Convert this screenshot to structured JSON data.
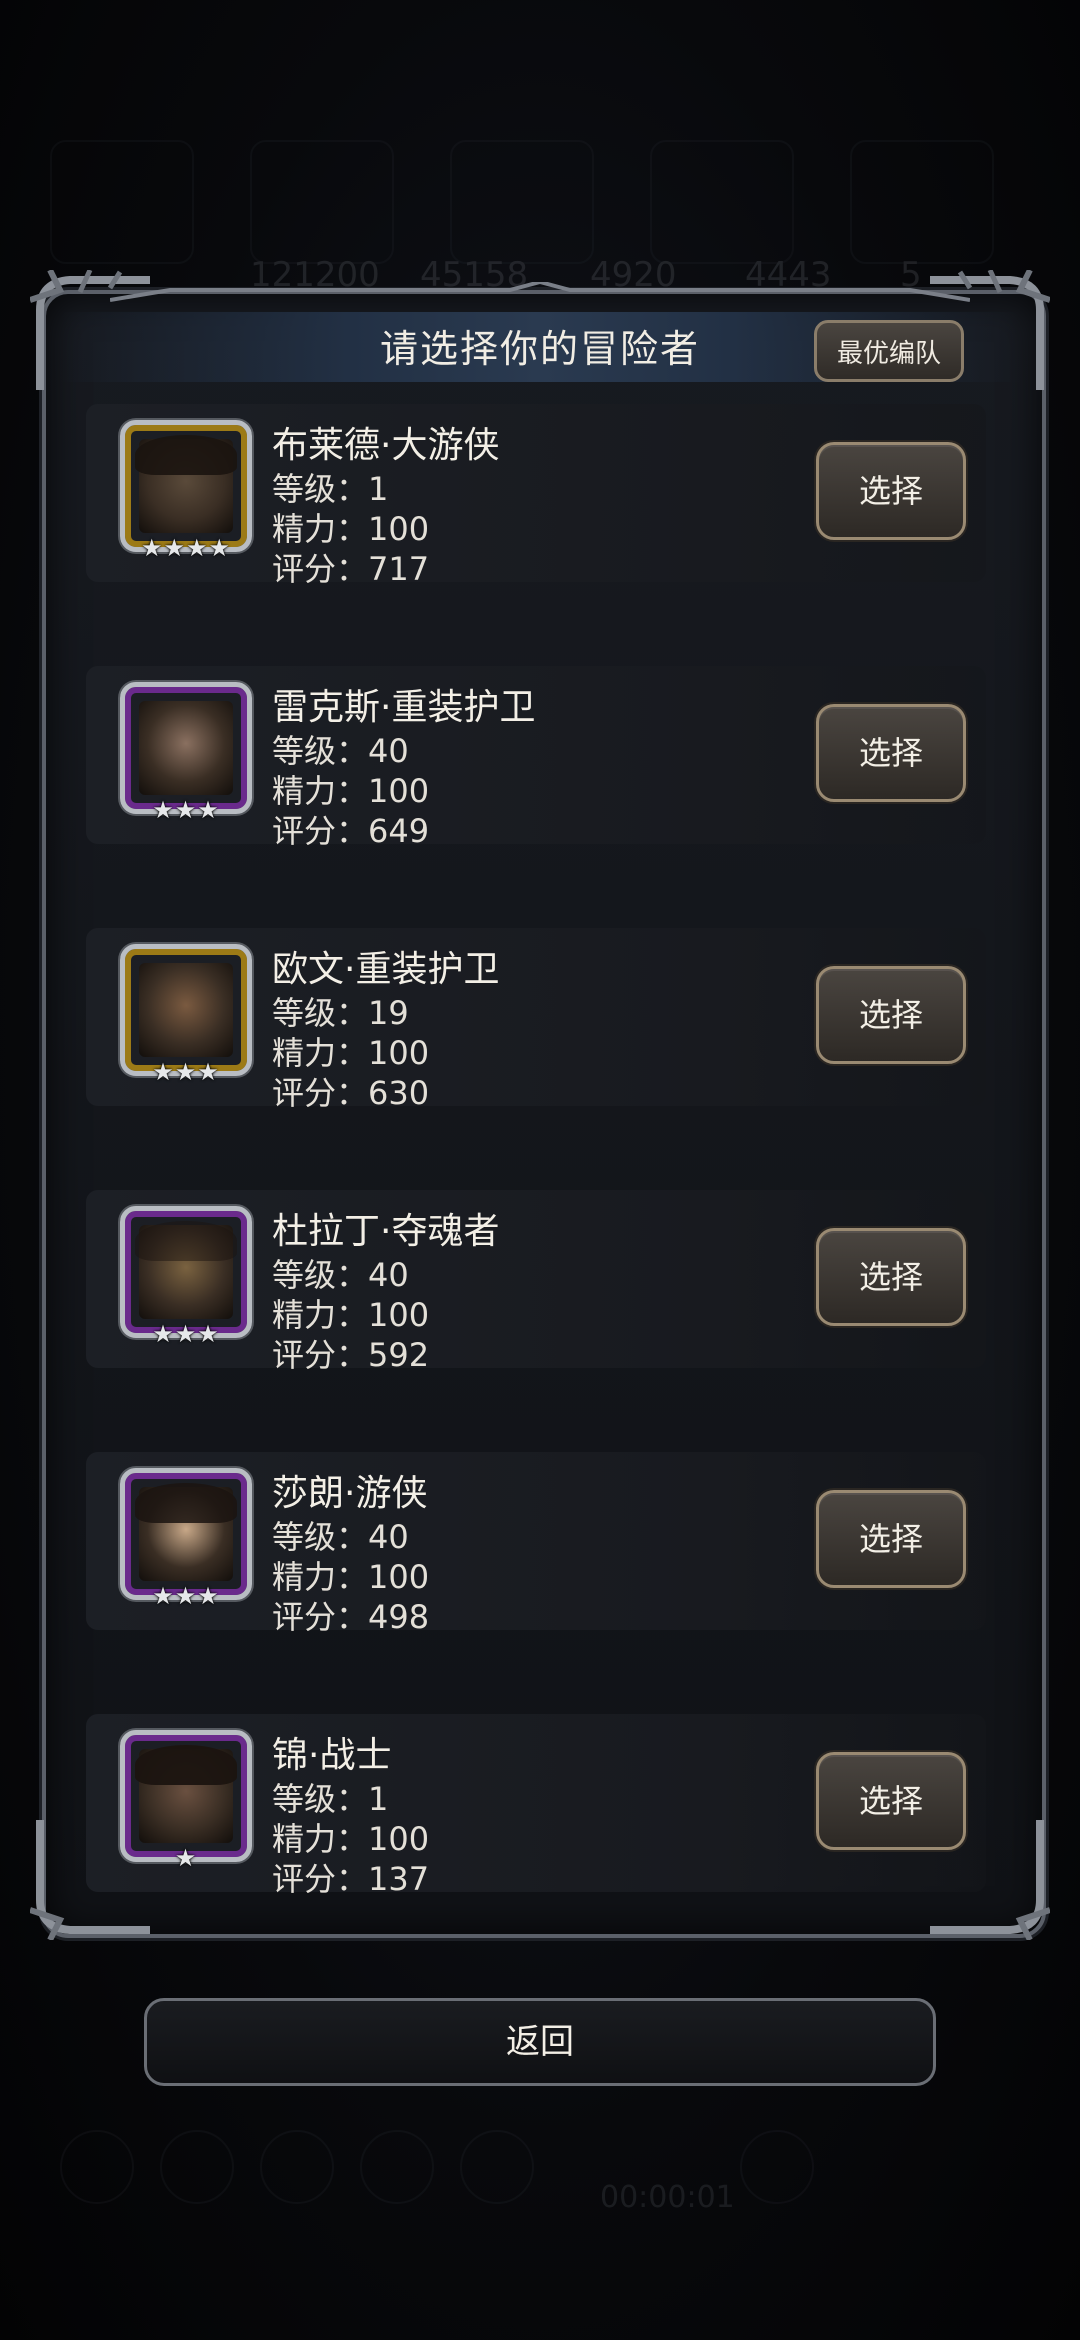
{
  "dialog": {
    "title": "请选择你的冒险者",
    "best_team_label": "最优编队"
  },
  "background_hud": {
    "numbers": [
      "121200",
      "45158",
      "4920",
      "4443",
      "5"
    ],
    "timer": "00:00:01"
  },
  "adventurers": [
    {
      "name": "布莱德·大游侠",
      "level": "等级：1",
      "energy": "精力：100",
      "score": "评分：717",
      "stars": "★★★★",
      "frame": "gold",
      "select_label": "选择"
    },
    {
      "name": "雷克斯·重装护卫",
      "level": "等级：40",
      "energy": "精力：100",
      "score": "评分：649",
      "stars": "★★★",
      "frame": "purple",
      "select_label": "选择"
    },
    {
      "name": "欧文·重装护卫",
      "level": "等级：19",
      "energy": "精力：100",
      "score": "评分：630",
      "stars": "★★★",
      "frame": "gold",
      "select_label": "选择"
    },
    {
      "name": "杜拉丁·夺魂者",
      "level": "等级：40",
      "energy": "精力：100",
      "score": "评分：592",
      "stars": "★★★",
      "frame": "purple",
      "select_label": "选择"
    },
    {
      "name": "莎朗·游侠",
      "level": "等级：40",
      "energy": "精力：100",
      "score": "评分：498",
      "stars": "★★★",
      "frame": "purple",
      "select_label": "选择"
    },
    {
      "name": "锦·战士",
      "level": "等级：1",
      "energy": "精力：100",
      "score": "评分：137",
      "stars": "★",
      "frame": "purple",
      "select_label": "选择"
    }
  ],
  "footer": {
    "back_label": "返回"
  },
  "colors": {
    "gold_frame": "#9c7a16",
    "purple_frame": "#6a2a8c",
    "button_border": "#9a8a72"
  }
}
